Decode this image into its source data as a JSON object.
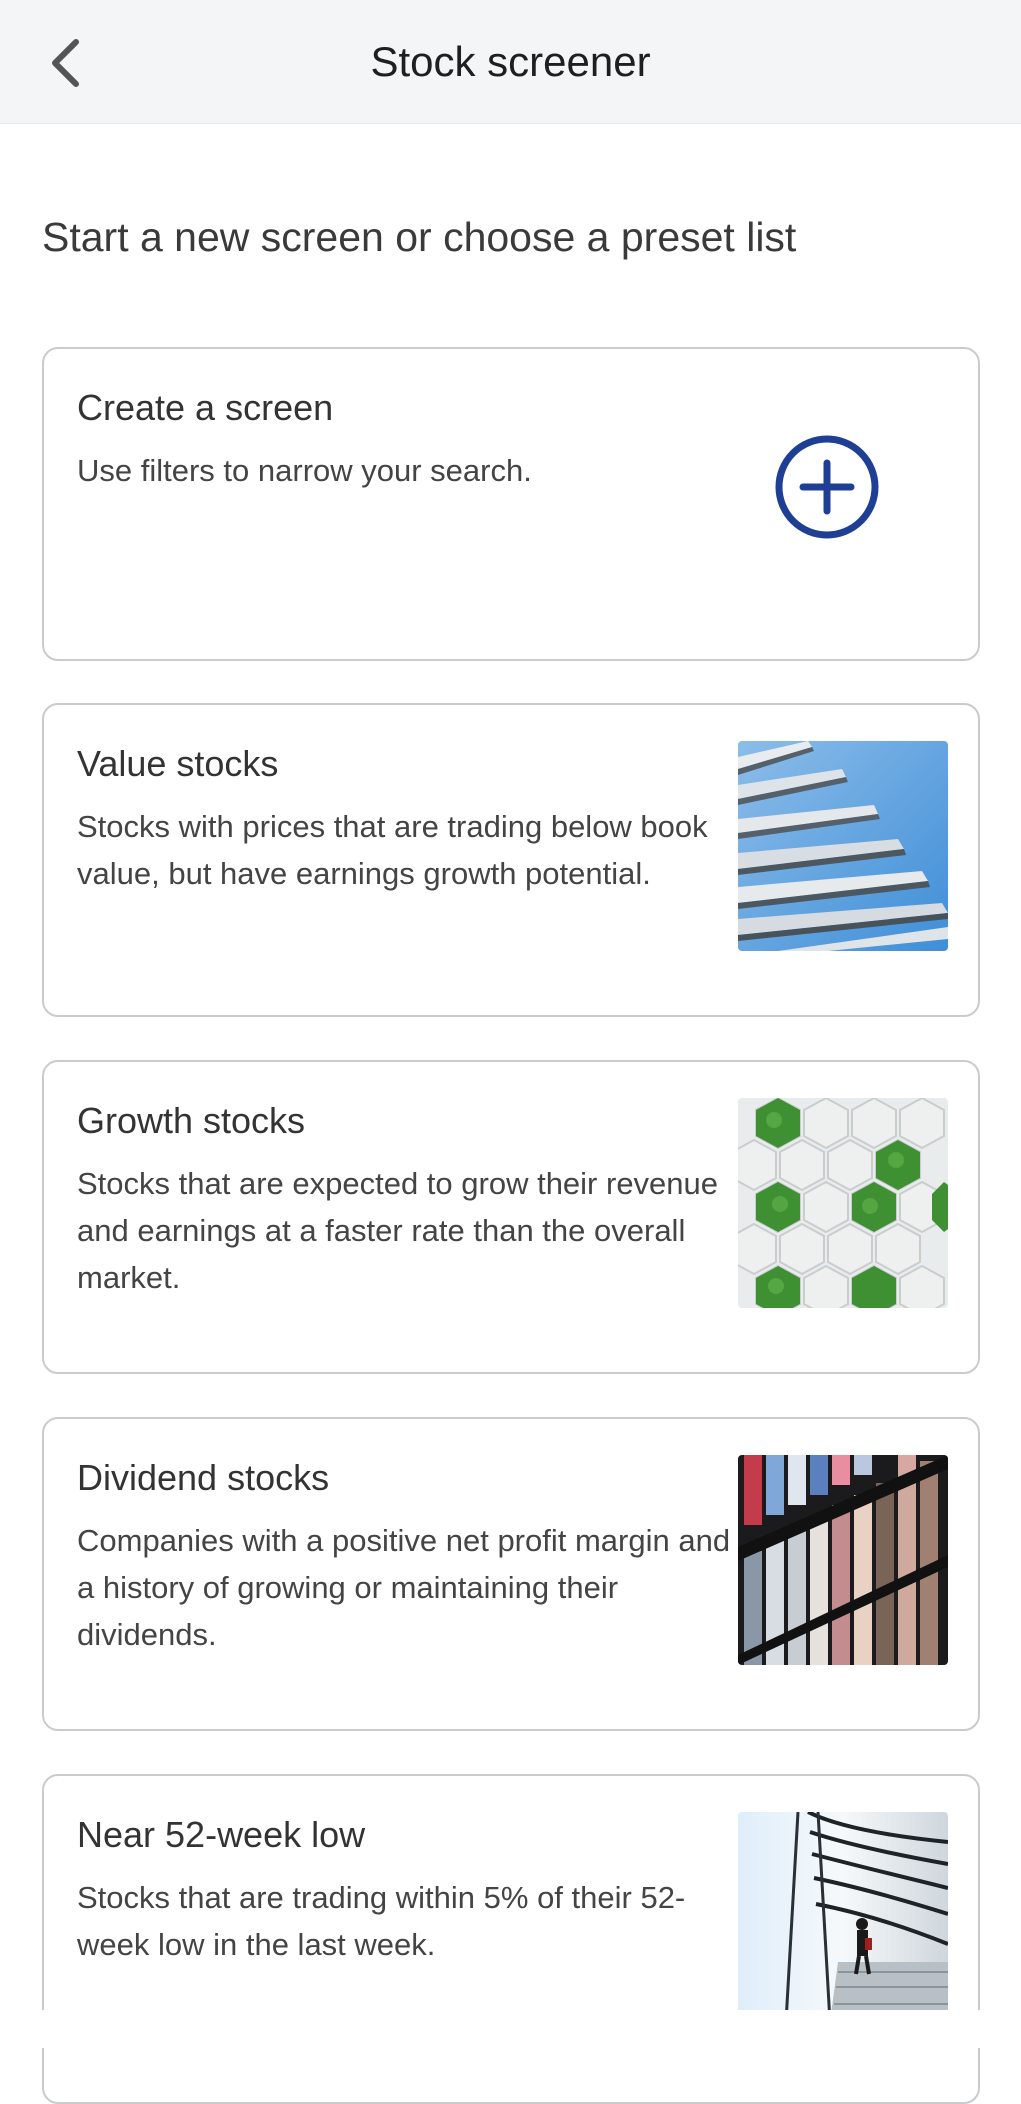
{
  "header": {
    "title": "Stock screener"
  },
  "intro": "Start a new screen or choose a preset list",
  "create_card": {
    "title": "Create a screen",
    "description": "Use filters to narrow your search."
  },
  "presets": [
    {
      "title": "Value stocks",
      "description": "Stocks with prices that are trading below book value, but have earnings growth potential."
    },
    {
      "title": "Growth stocks",
      "description": "Stocks that are expected to grow their revenue and earnings at a faster rate than the overall market."
    },
    {
      "title": "Dividend stocks",
      "description": "Companies with a positive net profit margin and a history of growing or maintaining their dividends."
    },
    {
      "title": "Near 52-week low",
      "description": "Stocks that are trading within 5% of their 52-week low in the last week."
    }
  ],
  "colors": {
    "accent": "#1f3f95",
    "header_bg": "#f4f5f7",
    "card_border": "#c9cbcf"
  },
  "icons": {
    "back": "chevron-left-icon",
    "create": "plus-circle-icon"
  }
}
